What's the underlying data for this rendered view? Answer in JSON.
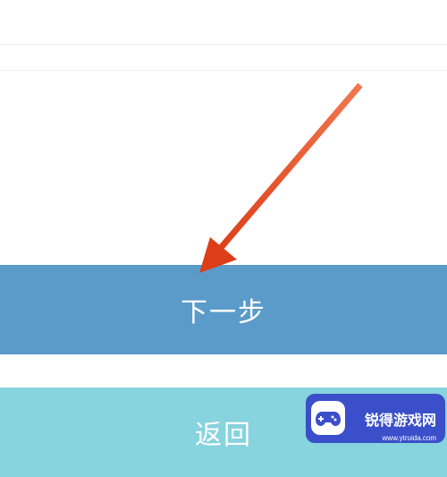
{
  "buttons": {
    "primary": {
      "label": "下一步"
    },
    "secondary": {
      "label": "返回"
    }
  },
  "watermark": {
    "text": "锐得游戏网",
    "url": "www.ytruida.com"
  },
  "annotation": {
    "arrow_color": "#e8582c"
  }
}
